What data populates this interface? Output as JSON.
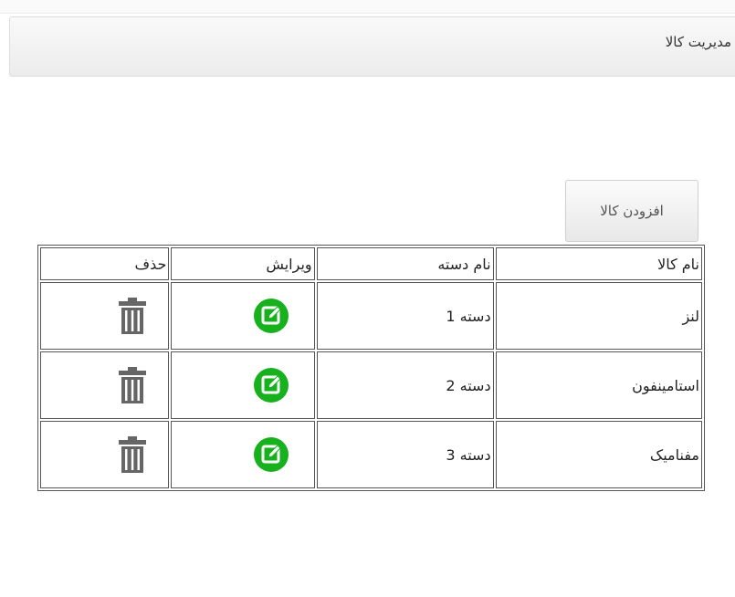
{
  "header": {
    "title": "مدیریت کالا"
  },
  "toolbar": {
    "add_label": "افزودن کالا"
  },
  "table": {
    "columns": [
      "نام کالا",
      "نام دسته",
      "ویرایش",
      "حذف"
    ],
    "rows": [
      {
        "name": "لنز",
        "category": "دسته 1"
      },
      {
        "name": "استامینفون",
        "category": "دسته 2"
      },
      {
        "name": "مفنامیک",
        "category": "دسته 3"
      }
    ]
  },
  "icons": {
    "edit": "edit-icon",
    "delete": "trash-icon"
  },
  "colors": {
    "edit_icon": "#17b11d",
    "trash_icon": "#666666",
    "border": "#555555"
  }
}
